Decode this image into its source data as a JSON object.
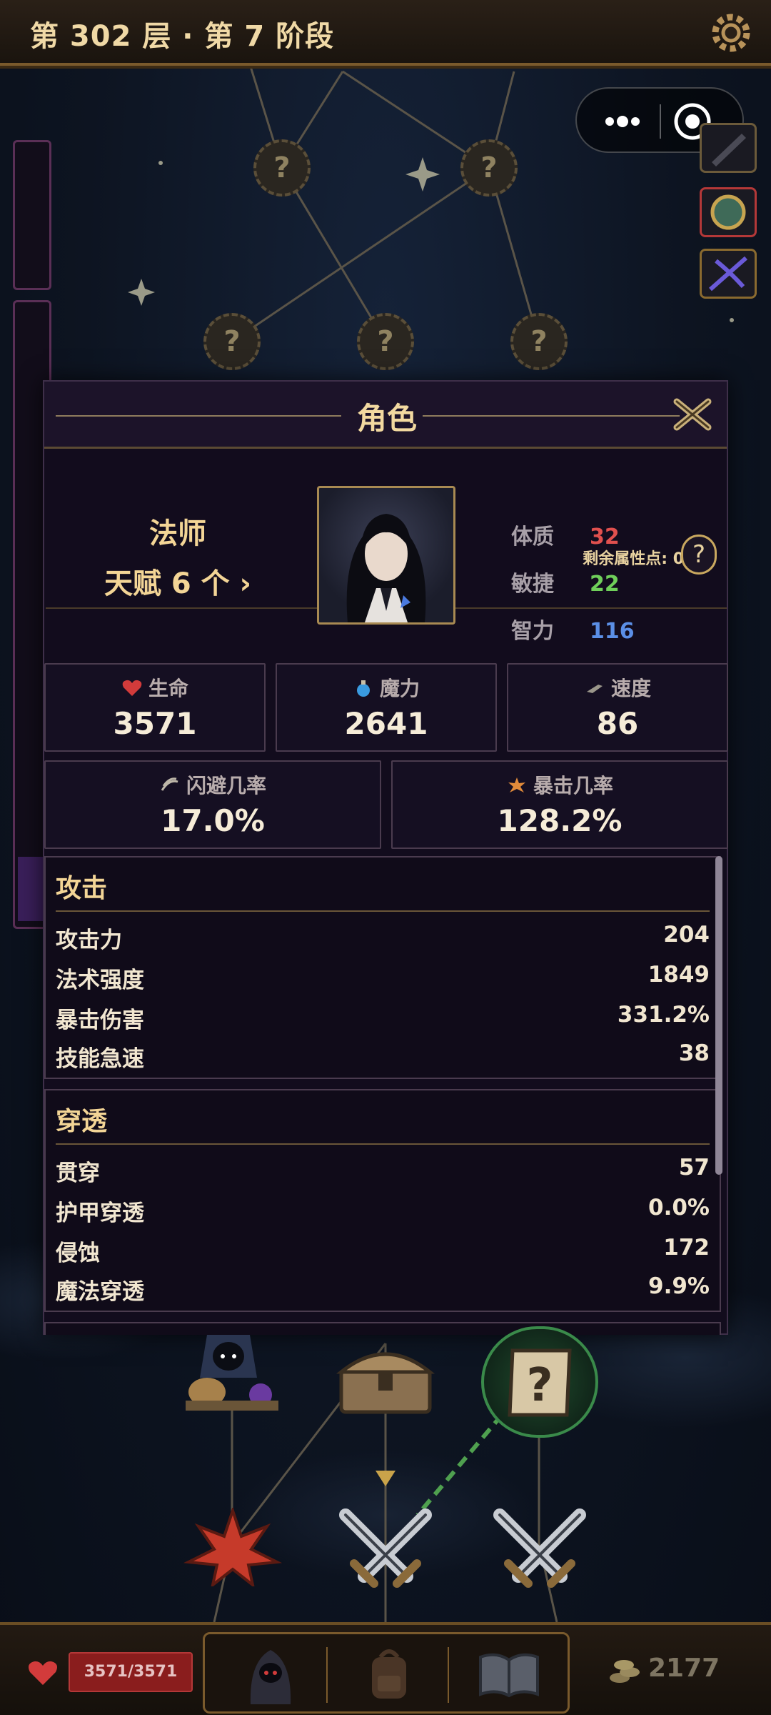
{
  "header": {
    "title": "第 302 层 · 第 7 阶段"
  },
  "map": {
    "unknown_marker": "?"
  },
  "panel": {
    "title": "角色",
    "class_name": "法师",
    "talent_label": "天赋 6 个 ›",
    "attribute_points_label": "剩余属性点: 0",
    "help_label": "?",
    "attributes": [
      {
        "name": "体质",
        "value": "32",
        "color": "#e0504e"
      },
      {
        "name": "敏捷",
        "value": "22",
        "color": "#6fcf5a"
      },
      {
        "name": "智力",
        "value": "116",
        "color": "#5b8fe6"
      }
    ],
    "stats": [
      {
        "label": "生命",
        "value": "3571",
        "icon": "heart-icon"
      },
      {
        "label": "魔力",
        "value": "2641",
        "icon": "mana-potion-icon"
      },
      {
        "label": "速度",
        "value": "86",
        "icon": "boot-wing-icon"
      },
      {
        "label": "闪避几率",
        "value": "17.0%",
        "icon": "dodge-icon"
      },
      {
        "label": "暴击几率",
        "value": "128.2%",
        "icon": "crit-icon"
      }
    ],
    "sections": [
      {
        "title": "攻击",
        "rows": [
          {
            "key": "攻击力",
            "value": "204"
          },
          {
            "key": "法术强度",
            "value": "1849"
          },
          {
            "key": "暴击伤害",
            "value": "331.2%"
          },
          {
            "key": "技能急速",
            "value": "38"
          }
        ]
      },
      {
        "title": "穿透",
        "rows": [
          {
            "key": "贯穿",
            "value": "57"
          },
          {
            "key": "护甲穿透",
            "value": "0.0%"
          },
          {
            "key": "侵蚀",
            "value": "172"
          },
          {
            "key": "魔法穿透",
            "value": "9.9%"
          }
        ]
      }
    ]
  },
  "bottom": {
    "hp_text": "3571/3571",
    "gold": "2177",
    "nav_icons": [
      "hooded-hero-icon",
      "backpack-icon",
      "book-icon"
    ]
  },
  "colors": {
    "accent_gold": "#f3d596",
    "panel_bg": "#120c1d",
    "frame_brown": "#7a5a2c"
  }
}
